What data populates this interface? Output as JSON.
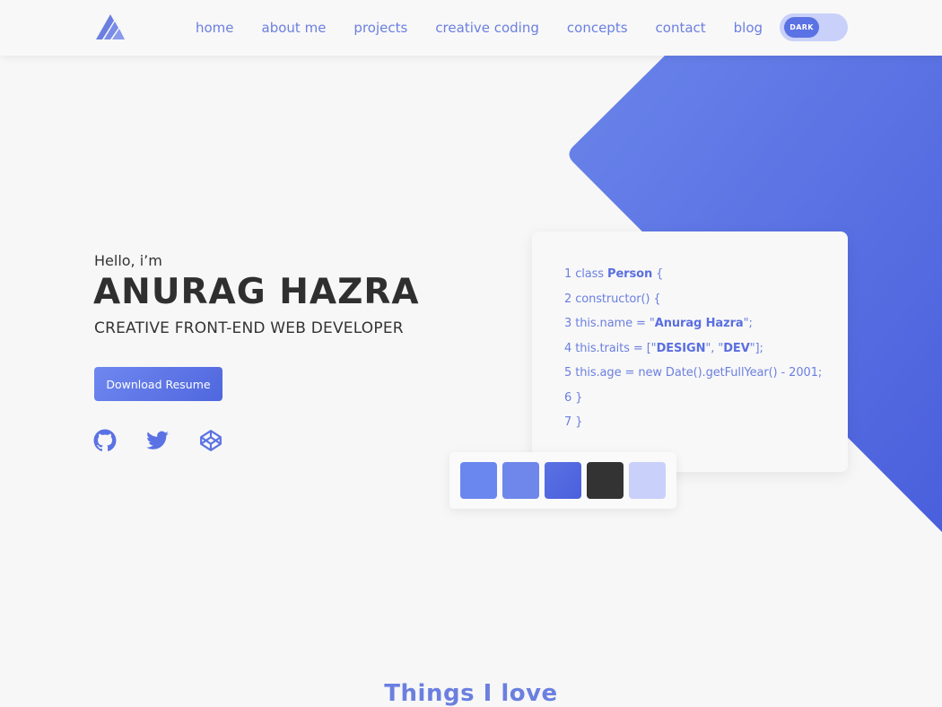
{
  "nav": {
    "links": [
      "home",
      "about me",
      "projects",
      "creative coding",
      "concepts",
      "contact",
      "blog"
    ],
    "toggle_label": "DARK"
  },
  "hero": {
    "greeting": "Hello, i’m",
    "name": "ANURAG HAZRA",
    "role": "CREATIVE FRONT-END WEB DEVELOPER",
    "resume_button": "Download Resume",
    "social_icons": [
      "github-icon",
      "twitter-icon",
      "codepen-icon"
    ]
  },
  "code": {
    "lines": [
      [
        {
          "t": "1 class "
        },
        {
          "t": "Person",
          "b": true
        },
        {
          "t": " {"
        }
      ],
      [
        {
          "t": "2 constructor() {"
        }
      ],
      [
        {
          "t": "3 this.name = \""
        },
        {
          "t": "Anurag Hazra",
          "b": true
        },
        {
          "t": "\";"
        }
      ],
      [
        {
          "t": "4 this.traits = [\""
        },
        {
          "t": "DESIGN",
          "b": true
        },
        {
          "t": "\", \""
        },
        {
          "t": "DEV",
          "b": true
        },
        {
          "t": "\"];"
        }
      ],
      [
        {
          "t": "5 this.age = new Date().getFullYear() - 2001;"
        }
      ],
      [
        {
          "t": "6 }"
        }
      ],
      [
        {
          "t": "7 }"
        }
      ]
    ]
  },
  "palette": {
    "colors": [
      "#6a87ef",
      "#6f86ea",
      "#5b72e3",
      "#333333",
      "#c9d0fa"
    ]
  },
  "colors": {
    "accent": "#6b7fe0",
    "shape_start": "#6a84ea",
    "shape_end": "#4a5fdc",
    "text_dark": "#2f2f2f"
  },
  "section": {
    "title": "Things I love"
  }
}
